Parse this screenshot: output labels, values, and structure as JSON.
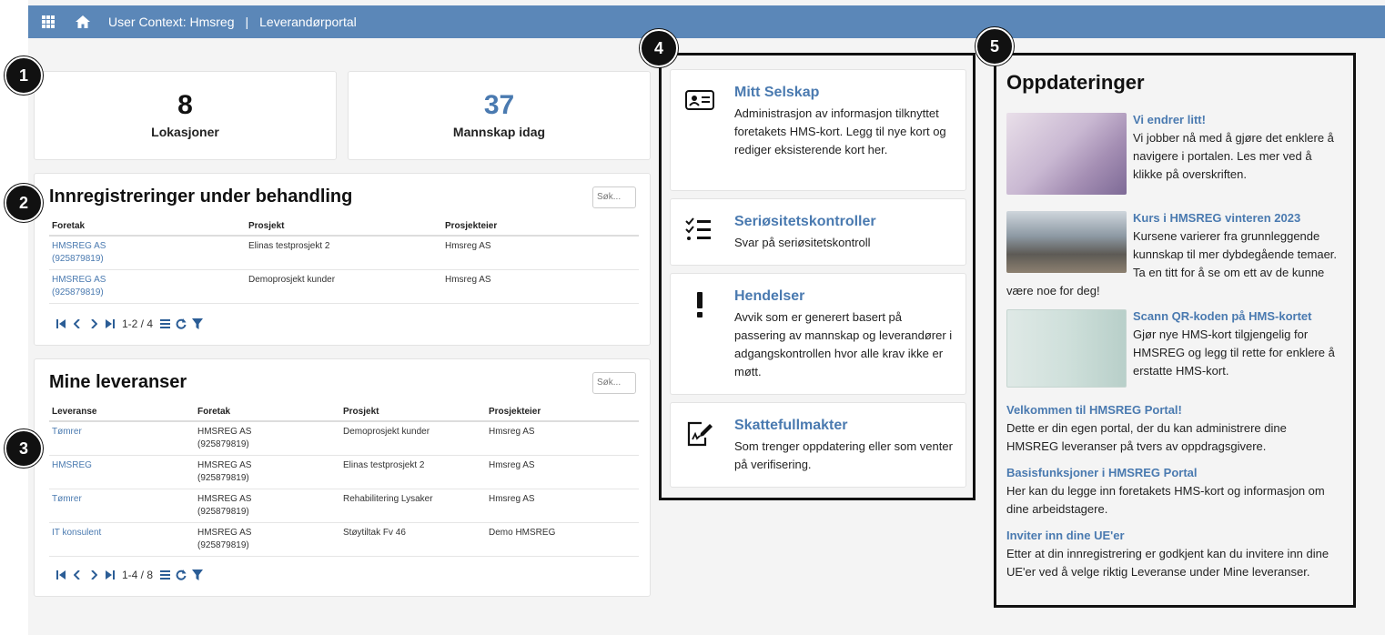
{
  "topbar": {
    "user_context": "User Context: Hmsreg",
    "separator": "|",
    "portal": "Leverandørportal"
  },
  "stats": [
    {
      "value": "8",
      "label": "Lokasjoner",
      "color": "#111111"
    },
    {
      "value": "37",
      "label": "Mannskap idag",
      "color": "#4a7ab0"
    }
  ],
  "registrations": {
    "title": "Innregistreringer under behandling",
    "search_placeholder": "Søk...",
    "headers": [
      "Foretak",
      "Prosjekt",
      "Prosjekteier"
    ],
    "rows": [
      {
        "company": "HMSREG AS",
        "orgnr": "(925879819)",
        "project": "Elinas testprosjekt 2",
        "owner": "Hmsreg AS"
      },
      {
        "company": "HMSREG AS",
        "orgnr": "(925879819)",
        "project": "Demoprosjekt kunder",
        "owner": "Hmsreg AS"
      }
    ],
    "pager": "1-2 / 4"
  },
  "deliveries": {
    "title": "Mine leveranser",
    "search_placeholder": "Søk...",
    "headers": [
      "Leveranse",
      "Foretak",
      "Prosjekt",
      "Prosjekteier"
    ],
    "rows": [
      {
        "delivery": "Tømrer",
        "company": "HMSREG AS",
        "orgnr": "(925879819)",
        "project": "Demoprosjekt kunder",
        "owner": "Hmsreg AS"
      },
      {
        "delivery": "HMSREG",
        "company": "HMSREG AS",
        "orgnr": "(925879819)",
        "project": "Elinas testprosjekt 2",
        "owner": "Hmsreg AS"
      },
      {
        "delivery": "Tømrer",
        "company": "HMSREG AS",
        "orgnr": "(925879819)",
        "project": "Rehabilitering Lysaker",
        "owner": "Hmsreg AS"
      },
      {
        "delivery": "IT konsulent",
        "company": "HMSREG AS",
        "orgnr": "(925879819)",
        "project": "Støytiltak Fv 46",
        "owner": "Demo HMSREG"
      }
    ],
    "pager": "1-4 / 8"
  },
  "modules": [
    {
      "title": "Mitt Selskap",
      "desc": "Administrasjon av informasjon tilknyttet foretakets HMS-kort. Legg til nye kort og rediger eksisterende kort her.",
      "icon": "id-card-icon"
    },
    {
      "title": "Seriøsitetskontroller",
      "desc": "Svar på seriøsitetskontroll",
      "icon": "checklist-icon"
    },
    {
      "title": "Hendelser",
      "desc": "Avvik som er generert basert på passering av mannskap og leverandører i adgangskontrollen hvor alle krav ikke er møtt.",
      "icon": "exclamation-icon"
    },
    {
      "title": "Skattefullmakter",
      "desc": "Som trenger oppdatering eller som venter på verifisering.",
      "icon": "signed-document-icon"
    }
  ],
  "updates": {
    "title": "Oppdateringer",
    "items": [
      {
        "title": "Vi endrer litt!",
        "text": "Vi jobber nå med å gjøre det enklere å navigere i portalen. Les mer ved å klikke på overskriften."
      },
      {
        "title": "Kurs i HMSREG vinteren 2023",
        "text": "Kursene varierer fra grunnleggende kunnskap til mer dybdegående temaer. Ta en titt for å se om ett av de kunne være noe for deg!"
      },
      {
        "title": "Scann QR-koden på HMS-kortet",
        "text": "Gjør nye HMS-kort tilgjengelig for HMSREG og legg til rette for enklere å erstatte HMS-kort."
      },
      {
        "title": "Velkommen til HMSREG Portal!",
        "text": "Dette er din egen portal, der du kan administrere dine HMSREG leveranser på tvers av oppdragsgivere."
      },
      {
        "title": "Basisfunksjoner i HMSREG Portal",
        "text": "Her kan du legge inn foretakets HMS-kort og informasjon om dine arbeidstagere."
      },
      {
        "title": "Inviter inn dine UE'er",
        "text": "Etter at din innregistrering er godkjent kan du invitere inn dine UE'er ved å velge riktig Leveranse under Mine leveranser."
      }
    ]
  },
  "badges": [
    "1",
    "2",
    "3",
    "4",
    "5"
  ],
  "colors": {
    "topbar": "#5b87b8",
    "link": "#4a7ab0",
    "background": "#f4f4f4"
  }
}
